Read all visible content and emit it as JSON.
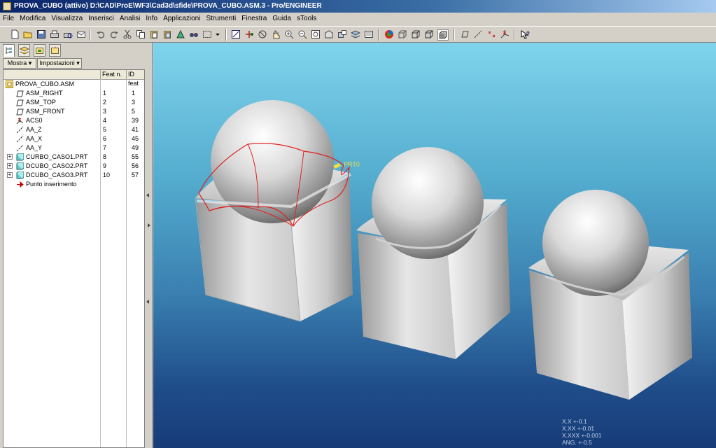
{
  "window": {
    "title": "PROVA_CUBO (attivo) D:\\CAD\\ProE\\WF3\\Cad3d\\sfide\\PROVA_CUBO.ASM.3 - Pro/ENGINEER"
  },
  "menu": [
    "File",
    "Modifica",
    "Visualizza",
    "Inserisci",
    "Analisi",
    "Info",
    "Applicazioni",
    "Strumenti",
    "Finestra",
    "Guida",
    "sTools"
  ],
  "toolbar_icons": [
    "new",
    "open",
    "save",
    "print",
    "print-preview",
    "email",
    "undo",
    "redo",
    "cut",
    "copy",
    "paste",
    "paste-special",
    "regenerate",
    "find",
    "select-box",
    "repaint",
    "spin-center",
    "orient",
    "pan",
    "zoom-in",
    "zoom-out",
    "refit",
    "view-manager",
    "saved-views",
    "layers",
    "appearance",
    "shading",
    "hidden-line",
    "no-hidden",
    "wireframe",
    "datum-planes",
    "datum-axes",
    "datum-points",
    "csys",
    "whats-this"
  ],
  "model_tree": {
    "tabs": [
      "model-tree",
      "layer-tree",
      "folder",
      "favorites"
    ],
    "show_button": "Mostra",
    "settings_button": "Impostazioni",
    "columns": {
      "feat_n": "Feat n.",
      "feat_id": "ID feat"
    },
    "root": "PROVA_CUBO.ASM",
    "items": [
      {
        "name": "ASM_RIGHT",
        "feat_n": "1",
        "feat_id": "1",
        "icon": "datum-plane-icon",
        "expandable": false
      },
      {
        "name": "ASM_TOP",
        "feat_n": "2",
        "feat_id": "3",
        "icon": "datum-plane-icon",
        "expandable": false
      },
      {
        "name": "ASM_FRONT",
        "feat_n": "3",
        "feat_id": "5",
        "icon": "datum-plane-icon",
        "expandable": false
      },
      {
        "name": "ACS0",
        "feat_n": "4",
        "feat_id": "39",
        "icon": "csys-icon",
        "expandable": false
      },
      {
        "name": "AA_Z",
        "feat_n": "5",
        "feat_id": "41",
        "icon": "datum-axis-icon",
        "expandable": false
      },
      {
        "name": "AA_X",
        "feat_n": "6",
        "feat_id": "45",
        "icon": "datum-axis-icon",
        "expandable": false
      },
      {
        "name": "AA_Y",
        "feat_n": "7",
        "feat_id": "49",
        "icon": "datum-axis-icon",
        "expandable": false
      },
      {
        "name": "CURBO_CASO1.PRT",
        "feat_n": "8",
        "feat_id": "55",
        "icon": "part-icon",
        "expandable": true
      },
      {
        "name": "DCUBO_CASO2.PRT",
        "feat_n": "9",
        "feat_id": "56",
        "icon": "part-icon",
        "expandable": true
      },
      {
        "name": "DCUBO_CASO3.PRT",
        "feat_n": "10",
        "feat_id": "57",
        "icon": "part-icon",
        "expandable": true
      },
      {
        "name": "Punto inserimento",
        "feat_n": "",
        "feat_id": "",
        "icon": "insert-arrow-icon",
        "expandable": false
      }
    ]
  },
  "viewport": {
    "datum_label": "PRT0",
    "tolerances": [
      "X.X +-0.1",
      "X.XX +-0.01",
      "X.XXX +-0.001",
      "ANG. +-0.5"
    ]
  },
  "colors": {
    "title_start": "#0a246a",
    "bg_top": "#7fd4ec",
    "bg_bottom": "#173c78",
    "highlight": "#e02020"
  }
}
